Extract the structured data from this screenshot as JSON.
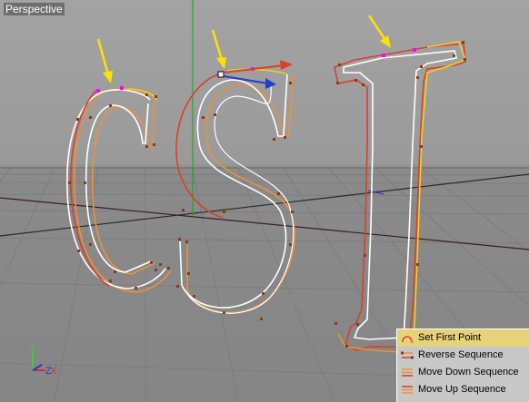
{
  "viewport": {
    "title": "Perspective"
  },
  "context_menu": {
    "items": [
      {
        "label": "Set First Point",
        "icon": "set-first-point-icon",
        "highlighted": true
      },
      {
        "label": "Reverse Sequence",
        "icon": "reverse-sequence-icon",
        "highlighted": false
      },
      {
        "label": "Move Down Sequence",
        "icon": "move-down-sequence-icon",
        "highlighted": false
      },
      {
        "label": "Move Up Sequence",
        "icon": "move-up-sequence-icon",
        "highlighted": false
      }
    ]
  },
  "axis_gizmo": {
    "y_label": "Y",
    "z_label": "Z",
    "x_label": "X"
  },
  "colors": {
    "spline_white": "#ffffff",
    "spline_orange": "#e8923c",
    "spline_red": "#d9402a",
    "spline_yellow": "#f0d020",
    "annotation_arrow": "#ffe000",
    "highlight": "#e6d27a"
  }
}
